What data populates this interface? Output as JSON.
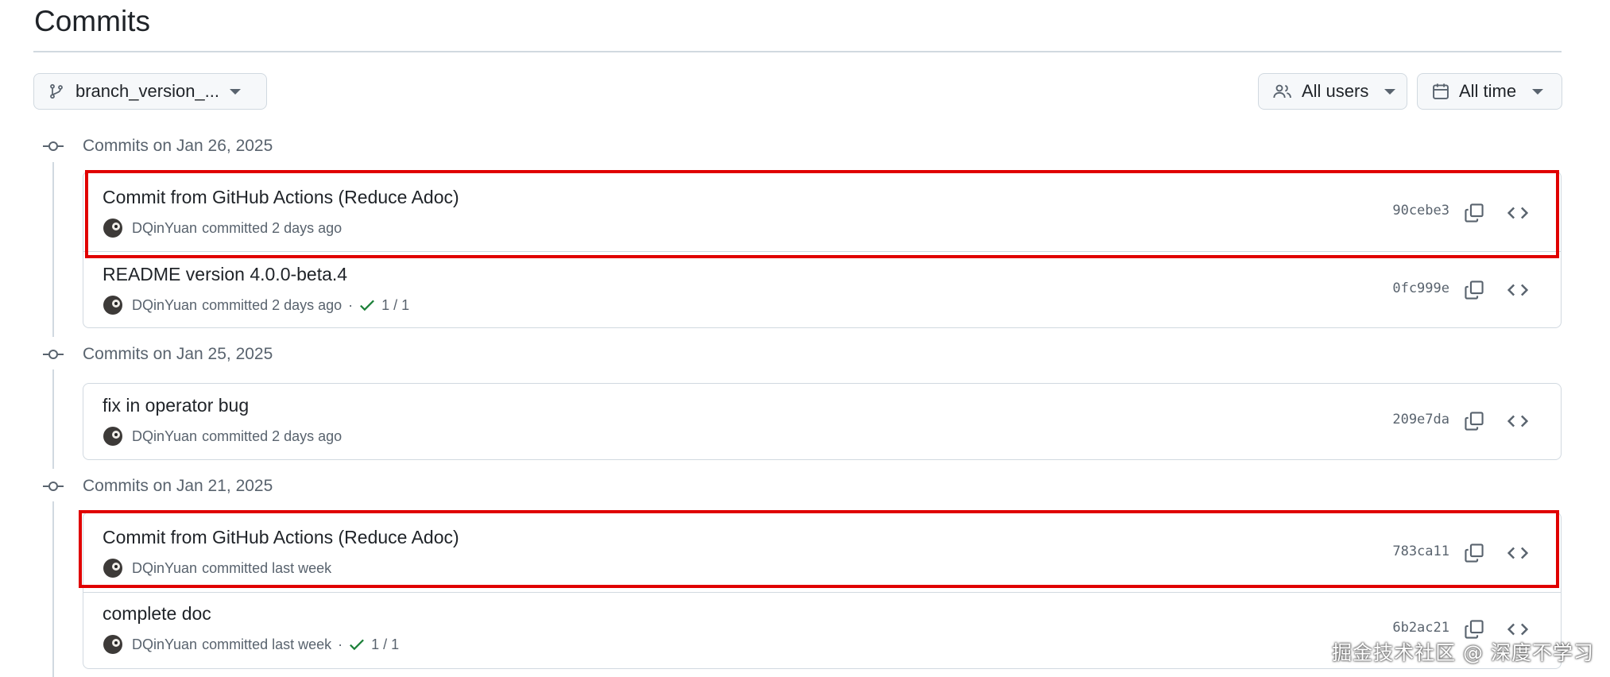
{
  "page": {
    "title": "Commits"
  },
  "toolbar": {
    "branch": {
      "label": "branch_version_...",
      "icon": "git-branch-icon"
    },
    "users": {
      "label": "All users",
      "icon": "people-icon"
    },
    "time": {
      "label": "All time",
      "icon": "calendar-icon"
    }
  },
  "groups": [
    {
      "label": "Commits on Jan 26, 2025",
      "commits": [
        {
          "title": "Commit from GitHub Actions (Reduce Adoc)",
          "author": "DQinYuan",
          "meta": "committed 2 days ago",
          "sha": "90cebe3",
          "checks": ""
        },
        {
          "title": "README version 4.0.0-beta.4",
          "author": "DQinYuan",
          "meta": "committed 2 days ago",
          "sha": "0fc999e",
          "checks": "1 / 1"
        }
      ]
    },
    {
      "label": "Commits on Jan 25, 2025",
      "commits": [
        {
          "title": "fix in operator bug",
          "author": "DQinYuan",
          "meta": "committed 2 days ago",
          "sha": "209e7da",
          "checks": ""
        }
      ]
    },
    {
      "label": "Commits on Jan 21, 2025",
      "commits": [
        {
          "title": "Commit from GitHub Actions (Reduce Adoc)",
          "author": "DQinYuan",
          "meta": "committed last week",
          "sha": "783ca11",
          "checks": ""
        },
        {
          "title": "complete doc",
          "author": "DQinYuan",
          "meta": "committed last week",
          "sha": "6b2ac21",
          "checks": "1 / 1"
        }
      ]
    }
  ],
  "watermark": "掘金技术社区 @ 深度不学习",
  "colors": {
    "highlight": "#e00000",
    "success": "#1a7f37",
    "border": "#d1d9e0",
    "muted": "#59636e"
  }
}
